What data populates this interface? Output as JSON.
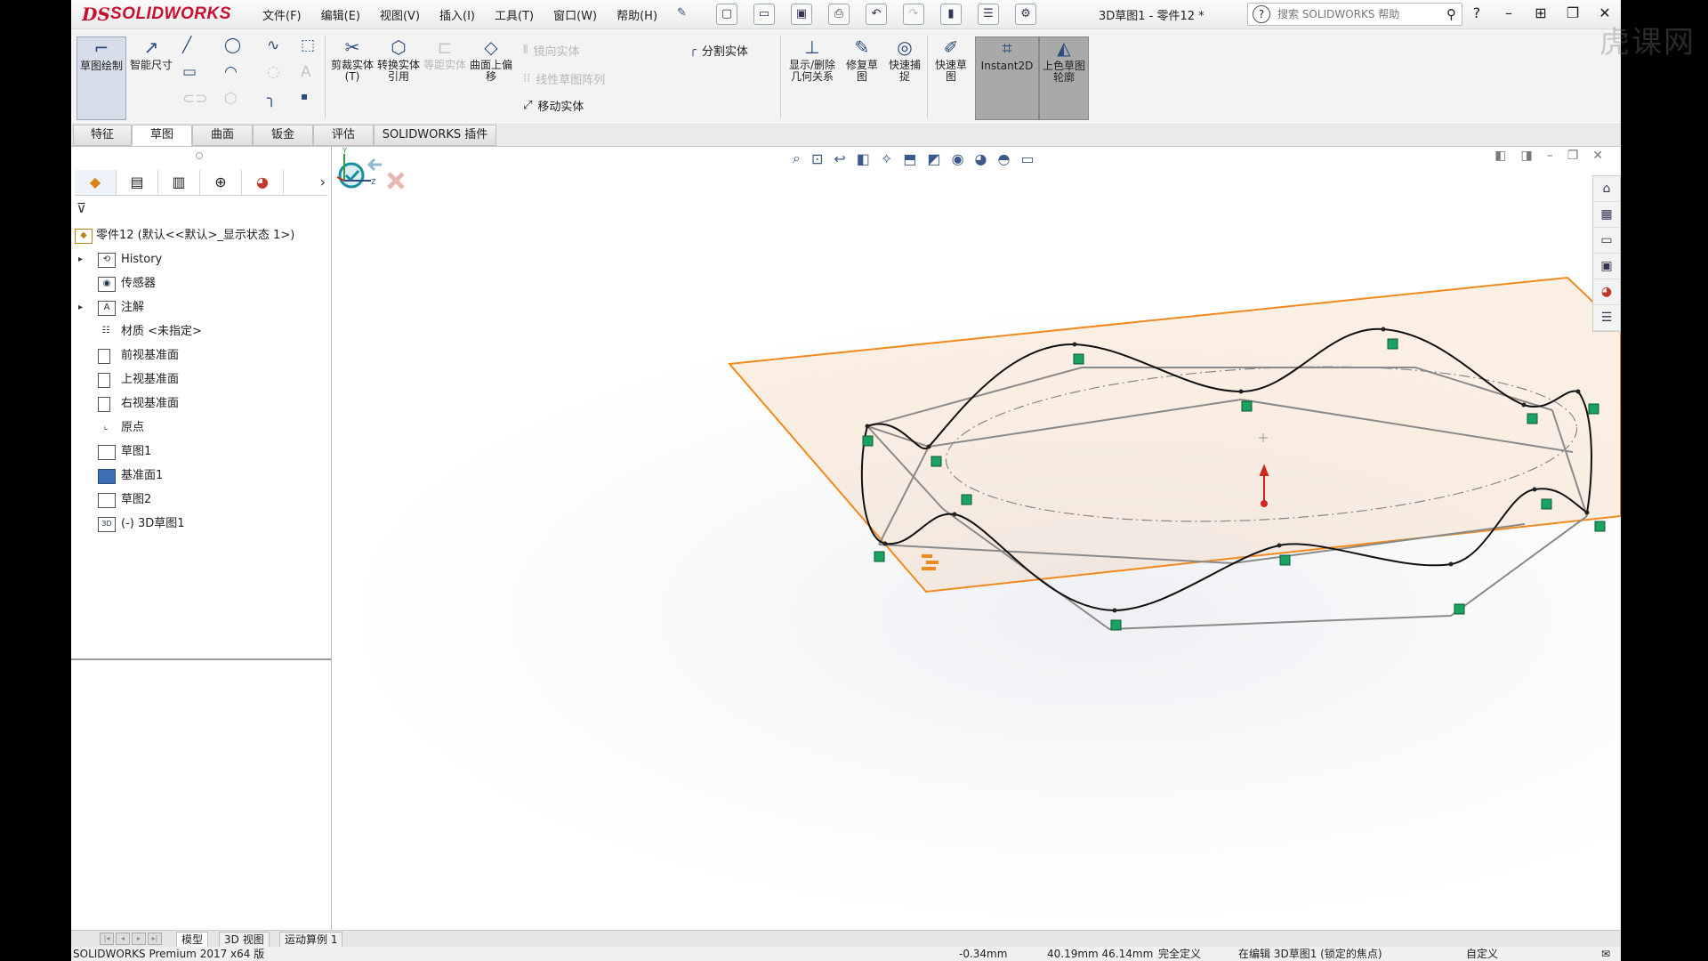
{
  "app": {
    "name": "SOLIDWORKS",
    "logo_mark": "DS"
  },
  "menu": [
    "文件(F)",
    "编辑(E)",
    "视图(V)",
    "插入(I)",
    "工具(T)",
    "窗口(W)",
    "帮助(H)"
  ],
  "document_title": "3D草图1 - 零件12 *",
  "help_search": {
    "placeholder": "搜索 SOLIDWORKS 帮助"
  },
  "commands": {
    "sketch": "草图绘制",
    "smart_dim": "智能尺寸",
    "trim": "剪裁实体(T)",
    "convert": "转换实体引用",
    "offset": "等距实体",
    "surface_offset": "曲面上偏移",
    "mirror": "镜向实体",
    "linear_pattern": "线性草图阵列",
    "move": "移动实体",
    "split": "分割实体",
    "relations": "显示/删除几何关系",
    "repair": "修复草图",
    "quick_snap": "快速捕捉",
    "rapid_sketch": "快速草图",
    "instant2d": "Instant2D",
    "shaded": "上色草图轮廓"
  },
  "tabs": [
    "特征",
    "草图",
    "曲面",
    "钣金",
    "评估",
    "SOLIDWORKS 插件"
  ],
  "active_tab": "草图",
  "tree": {
    "root": "零件12 (默认<<默认>_显示状态 1>)",
    "items": [
      {
        "label": "History",
        "icon": "history-icon",
        "expandable": true
      },
      {
        "label": "传感器",
        "icon": "sensor-icon",
        "expandable": false
      },
      {
        "label": "注解",
        "icon": "annotation-icon",
        "expandable": true
      },
      {
        "label": "材质 <未指定>",
        "icon": "material-icon",
        "expandable": false
      },
      {
        "label": "前视基准面",
        "icon": "plane-icon",
        "expandable": false
      },
      {
        "label": "上视基准面",
        "icon": "plane-icon",
        "expandable": false
      },
      {
        "label": "右视基准面",
        "icon": "plane-icon",
        "expandable": false
      },
      {
        "label": "原点",
        "icon": "origin-icon",
        "expandable": false
      },
      {
        "label": "草图1",
        "icon": "sketch-icon",
        "expandable": false
      },
      {
        "label": "基准面1",
        "icon": "plane-icon",
        "expandable": false
      },
      {
        "label": "草图2",
        "icon": "sketch-icon",
        "expandable": false
      },
      {
        "label": "(-) 3D草图1",
        "icon": "3dsketch-icon",
        "expandable": false
      }
    ]
  },
  "triad": {
    "y": "Y",
    "z": "Z"
  },
  "bottom_tabs": [
    "模型",
    "3D 视图",
    "运动算例 1"
  ],
  "status": {
    "product": "SOLIDWORKS Premium 2017 x64 版",
    "coord1": "-0.34mm",
    "coord2": "40.19mm 46.14mm",
    "defined": "完全定义",
    "editing": "在编辑 3D草图1 (锁定的焦点)",
    "units": "自定义"
  },
  "watermark": "虎课网",
  "colors": {
    "plane": "#f08a1e",
    "accent": "#2a4d7f",
    "point": "#1aa260"
  }
}
